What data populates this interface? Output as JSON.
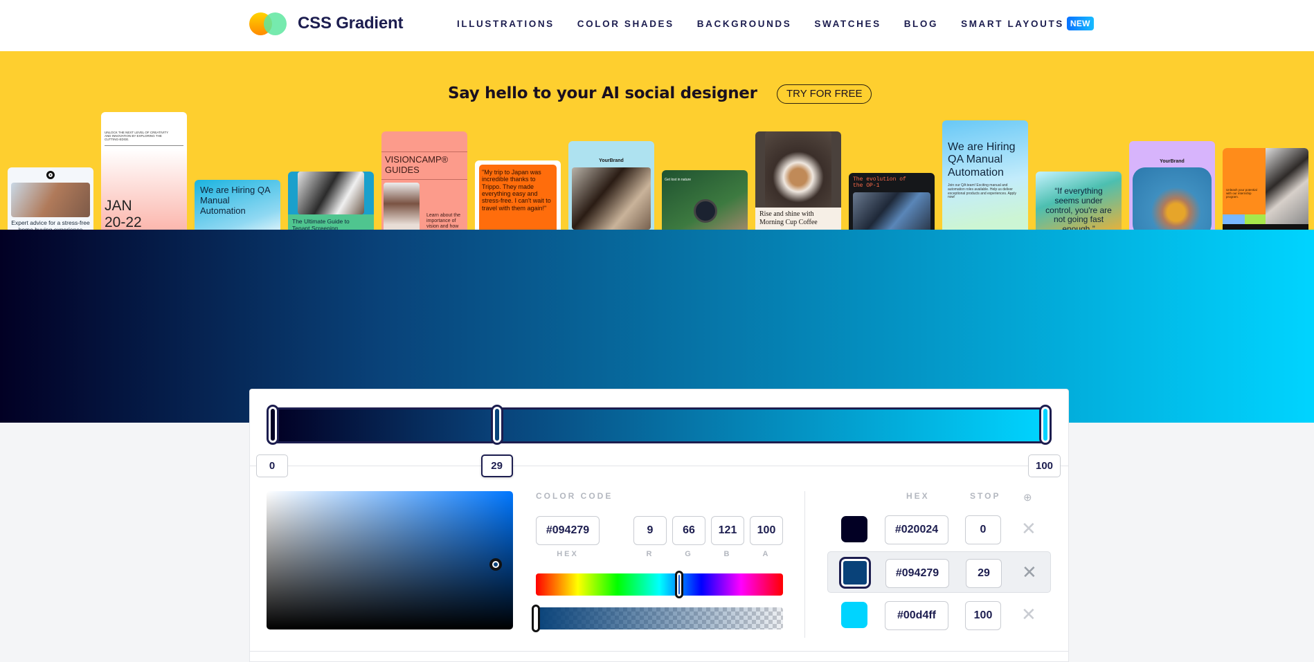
{
  "header": {
    "logo_text": "CSS Gradient",
    "nav": [
      {
        "label": "ILLUSTRATIONS"
      },
      {
        "label": "COLOR SHADES"
      },
      {
        "label": "BACKGROUNDS"
      },
      {
        "label": "SWATCHES"
      },
      {
        "label": "BLOG"
      },
      {
        "label": "SMART LAYOUTS",
        "badge": "NEW"
      }
    ]
  },
  "banner": {
    "title": "Say hello to your AI social designer",
    "cta": "TRY FOR FREE",
    "cards": [
      {
        "text": "Expert advice for a stress-free home buying experience"
      },
      {
        "text": "UNLOCK THE NEXT LEVEL OF CREATIVITY AND INNOVATION BY EXPLORING THE CUTTING-EDGE.",
        "headline": "JAN 20-22"
      },
      {
        "text": "We are Hiring QA Manual Automation"
      },
      {
        "text": "The Ultimate Guide to Tenant Screening"
      },
      {
        "text": "VISIONCAMP® GUIDES",
        "sub": "Learn about the importance of vision and how to make it a"
      },
      {
        "text": "\"My trip to Japan was incredible thanks to Trippo. They made everything easy and stress-free. I can't wait to travel with them again!\""
      },
      {
        "text": "YourBrand"
      },
      {
        "text": "Get lost in nature"
      },
      {
        "text": "Rise and shine with Morning Cup Coffee"
      },
      {
        "text": "The evolution of the OP-1"
      },
      {
        "text": "We are Hiring QA Manual Automation",
        "sub": "Join our QA team! Exciting manual and automation roles available. Help us deliver exceptional products and experiences. Apply now!"
      },
      {
        "text": "“If everything seems under control, you're are not going fast enough.”"
      },
      {
        "text": "YourBrand"
      },
      {
        "text": "Unleash your potential with our internship program."
      }
    ]
  },
  "gradient": {
    "stops": [
      {
        "hex": "#020024",
        "stop": "0"
      },
      {
        "hex": "#094279",
        "stop": "29"
      },
      {
        "hex": "#00d4ff",
        "stop": "100"
      }
    ],
    "active_stop_index": 1
  },
  "color_code": {
    "title": "COLOR CODE",
    "hex": "#094279",
    "r": "9",
    "g": "66",
    "b": "121",
    "a": "100",
    "labels": {
      "hex": "HEX",
      "r": "R",
      "g": "G",
      "b": "B",
      "a": "A"
    },
    "hue_fraction": 0.58,
    "alpha_fraction": 1.0,
    "saturation_fraction": 0.93,
    "value_fraction": 0.47
  },
  "stops_table": {
    "hex_header": "HEX",
    "stop_header": "STOP",
    "add_icon": "⊕",
    "delete_icon": "✕"
  }
}
